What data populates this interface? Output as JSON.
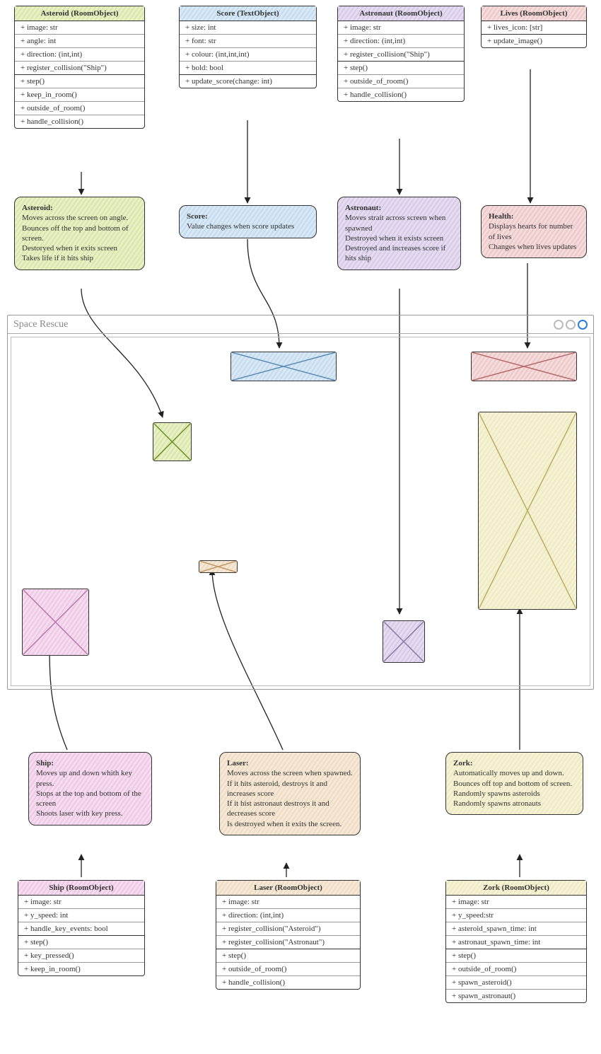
{
  "classes": {
    "asteroid": {
      "title": "Asteroid (RoomObject)",
      "attrs": [
        "+ image: str",
        "+ angle: int",
        "+ direction: (int,int)",
        "+ register_collision(\"Ship\")"
      ],
      "methods": [
        "+ step()",
        "+ keep_in_room()",
        "+ outside_of_room()",
        "+ handle_collision()"
      ]
    },
    "score": {
      "title": "Score (TextObject)",
      "attrs": [
        "+ size: int",
        "+ font: str",
        "+ colour: (int,int,int)",
        "+ bold: bool"
      ],
      "methods": [
        "+ update_score(change: int)"
      ]
    },
    "astronaut": {
      "title": "Astronaut (RoomObject)",
      "attrs": [
        "+ image: str",
        "+ direction: (int,int)",
        "+ register_collision(\"Ship\")"
      ],
      "methods": [
        "+ step()",
        "+ outside_of_room()",
        "+ handle_collision()"
      ]
    },
    "lives": {
      "title": "Lives (RoomObject)",
      "attrs": [
        "+ lives_icon: [str]"
      ],
      "methods": [
        "+ update_image()"
      ]
    },
    "ship": {
      "title": "Ship (RoomObject)",
      "attrs": [
        "+ image: str",
        "+ y_speed: int",
        "+ handle_key_events: bool"
      ],
      "methods": [
        "+ step()",
        "+ key_pressed()",
        "+ keep_in_room()"
      ]
    },
    "laser": {
      "title": "Laser (RoomObject)",
      "attrs": [
        "+ image: str",
        "+ direction: (int,int)",
        "+ register_collision(\"Asteroid\")",
        "+ register_collision(\"Astronaut\")"
      ],
      "methods": [
        "+ step()",
        "+ outside_of_room()",
        "+ handle_collision()"
      ]
    },
    "zork": {
      "title": "Zork (RoomObject)",
      "attrs": [
        "+ image: str",
        "+ y_speed:str",
        "+ asteroid_spawn_time: int",
        "+ astronaut_spawn_time: int"
      ],
      "methods": [
        "+ step()",
        "+ outside_of_room()",
        "+ spawn_asteroid()",
        "+ spawn_astronaut()"
      ]
    }
  },
  "notes": {
    "asteroid": {
      "title": "Asteroid:",
      "body": "Moves across the screen on angle.\nBounces off the top and bottom of screen.\nDestoryed when it exits screen\nTakes life if it hits ship"
    },
    "score": {
      "title": "Score:",
      "body": "Value changes when score updates"
    },
    "astronaut": {
      "title": "Astronaut:",
      "body": "Moves strait across screen when spawned\nDestroyed when it exists screen\nDestroyed and increases score if hits ship"
    },
    "health": {
      "title": "Health:",
      "body": "Displays hearts for number of lives\nChanges when lives updates"
    },
    "ship": {
      "title": "Ship:",
      "body": "Moves up and down whith key press.\nStops at the top and bottom of the screen\nShoots laser with key press."
    },
    "laser": {
      "title": "Laser:",
      "body": "Moves across the screen when spawned.\nIf it hits asteroid, destroys it and increases score\nIf it hist astronaut destroys it and decreases score\nIs destroyed when it exits the screen."
    },
    "zork": {
      "title": "Zork:",
      "body": "Automatically moves up and down.\nBounces off top and bottom of screen.\nRandomly spawns asteroids\nRandomly spawns atronauts"
    }
  },
  "window": {
    "title": "Space Rescue"
  },
  "colors": {
    "green": "#6b8e23",
    "blue": "#5b8bb5",
    "purple": "#8a78a8",
    "red": "#b86b6b",
    "pink": "#b878a8",
    "orange": "#c29760",
    "yellow": "#b8b060"
  }
}
